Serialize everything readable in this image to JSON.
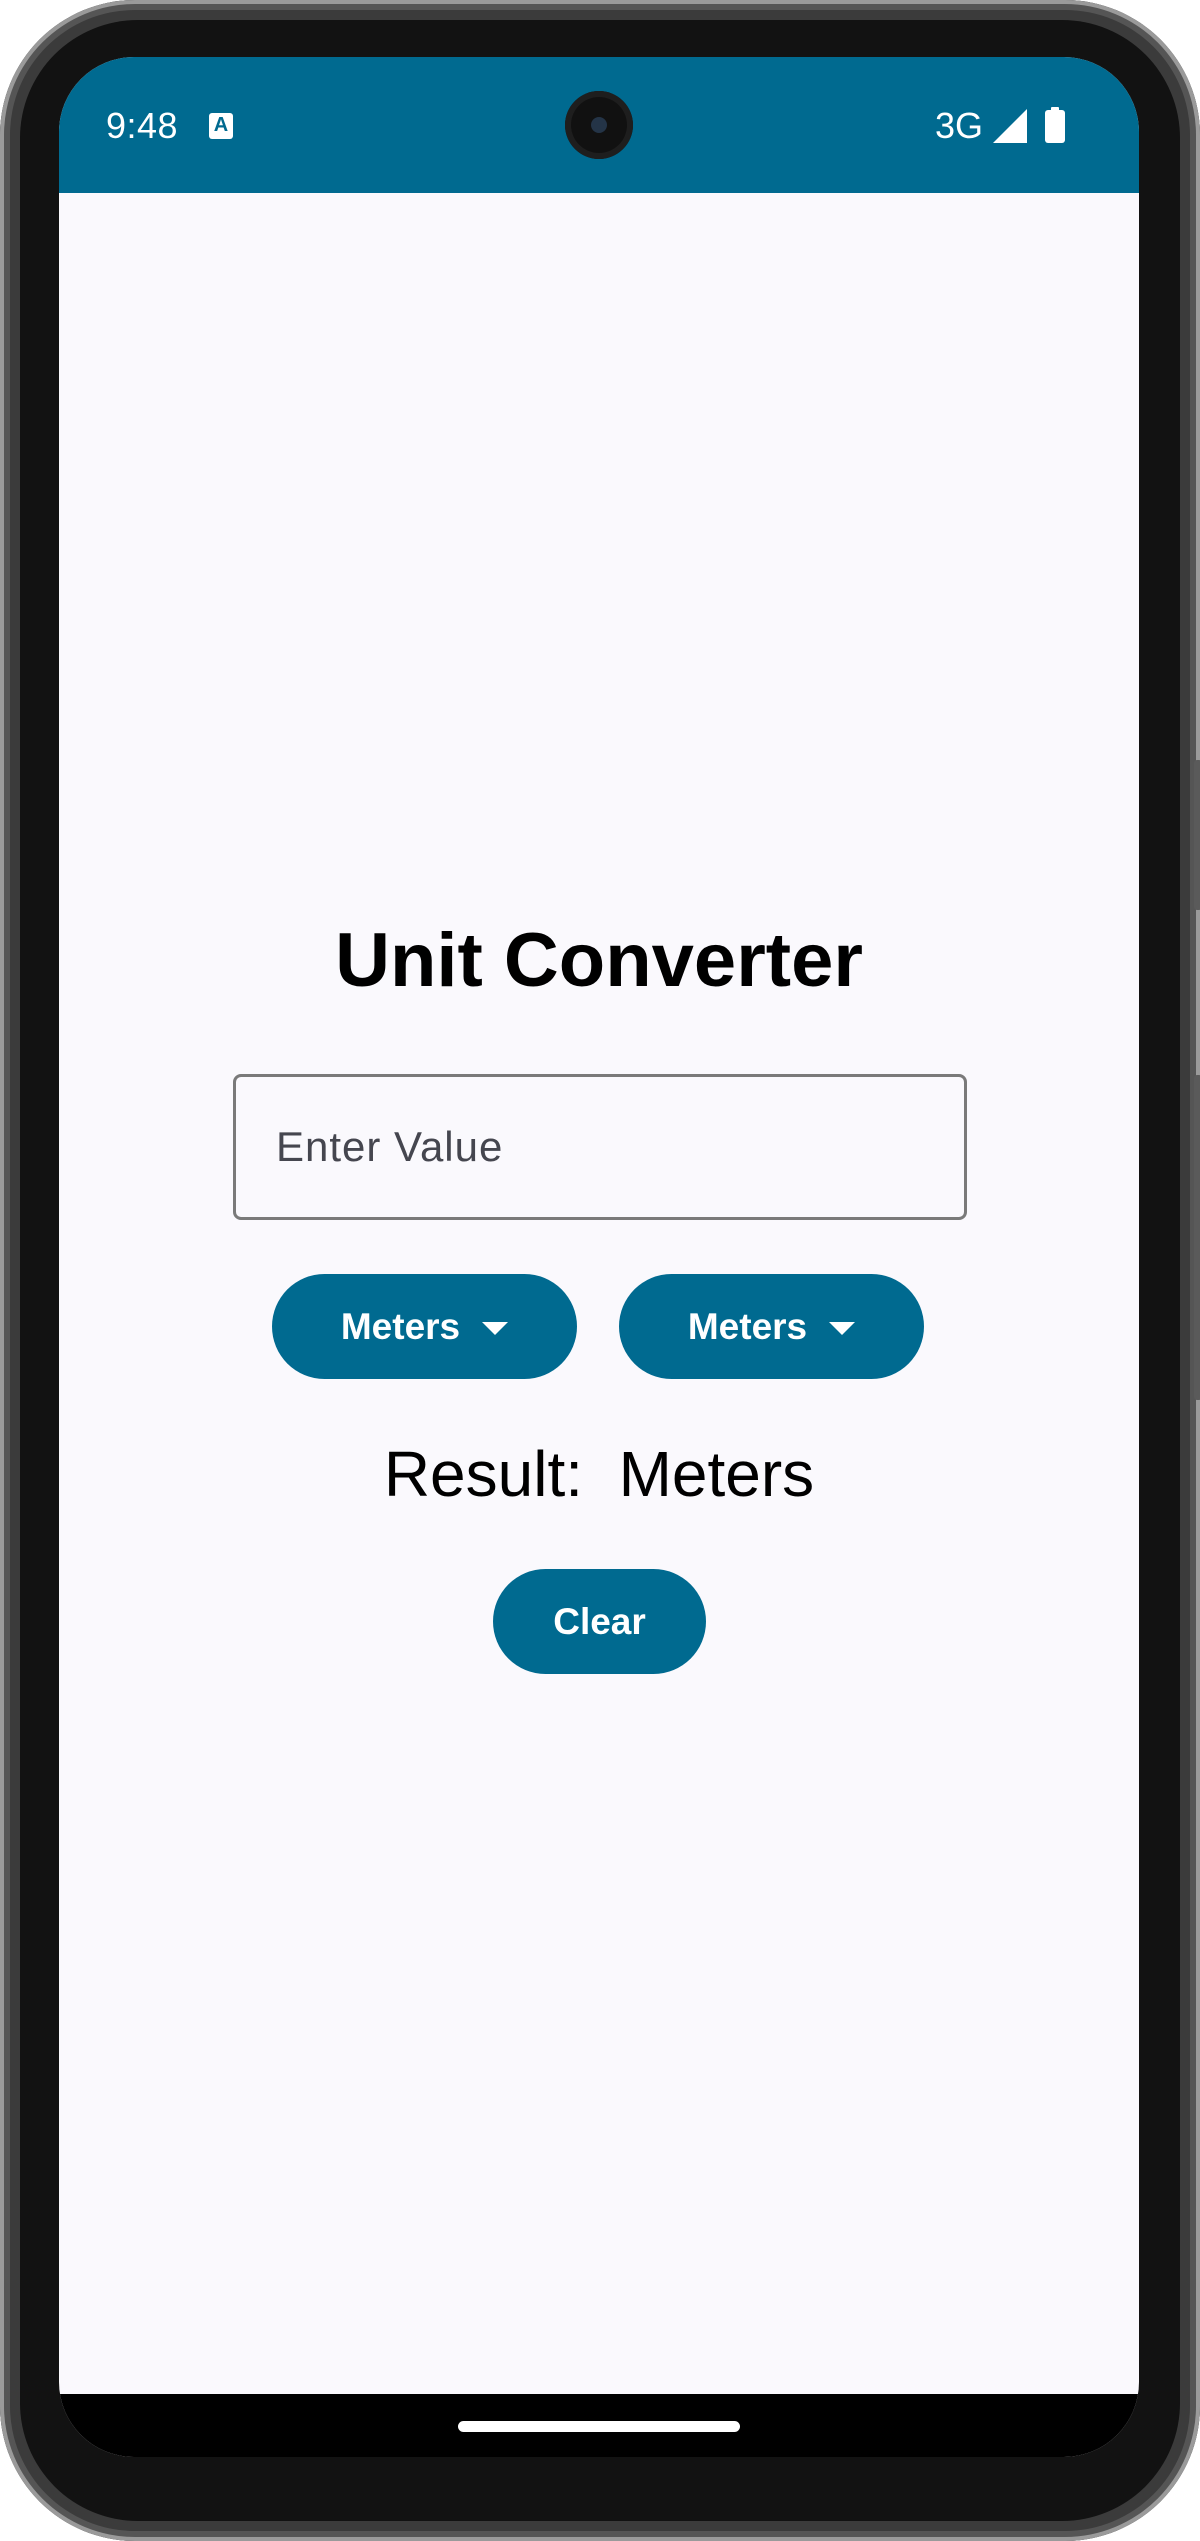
{
  "status_bar": {
    "time": "9:48",
    "notification_icon_glyph": "A",
    "network": "3G",
    "signal_icon": "signal-icon",
    "battery_icon": "battery-icon",
    "color": "#006a90"
  },
  "app": {
    "title": "Unit Converter",
    "input": {
      "placeholder": "Enter Value",
      "value": ""
    },
    "from_unit": {
      "selected": "Meters",
      "icon": "caret-down-icon"
    },
    "to_unit": {
      "selected": "Meters",
      "icon": "caret-down-icon"
    },
    "result": {
      "label": "Result:",
      "value": "Meters"
    },
    "clear_label": "Clear"
  },
  "colors": {
    "primary": "#006a90",
    "background": "#faf9fd",
    "text": "#000000"
  }
}
